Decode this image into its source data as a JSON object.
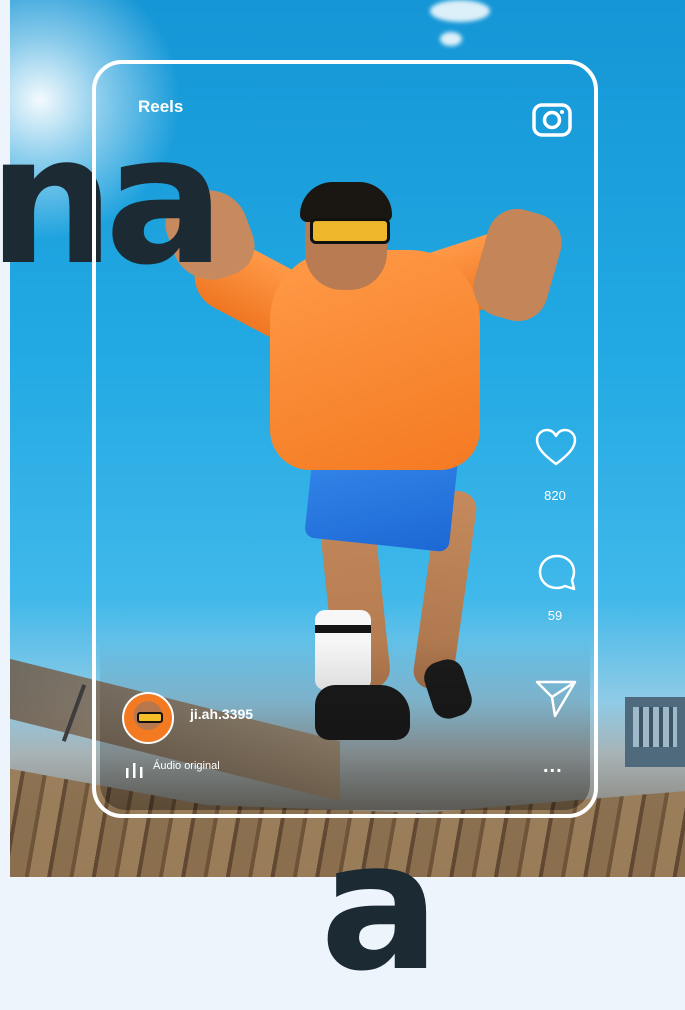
{
  "header": {
    "title": "Reels"
  },
  "icons": {
    "camera": "camera-icon",
    "like": "heart-icon",
    "comment": "comment-icon",
    "share": "send-icon",
    "more": "more-icon",
    "audio": "audio-bars-icon"
  },
  "actions": {
    "likes_count": "820",
    "comments_count": "59"
  },
  "post": {
    "username": "ji.ah.3395",
    "audio_label": "Áudio original",
    "more_label": "..."
  },
  "background_text": {
    "top": "na",
    "bottom": "a"
  },
  "colors": {
    "card_border": "#ffffff",
    "heading_text": "#1c2a33",
    "sky": "#22a9e3",
    "hoodie": "#f47a22"
  }
}
